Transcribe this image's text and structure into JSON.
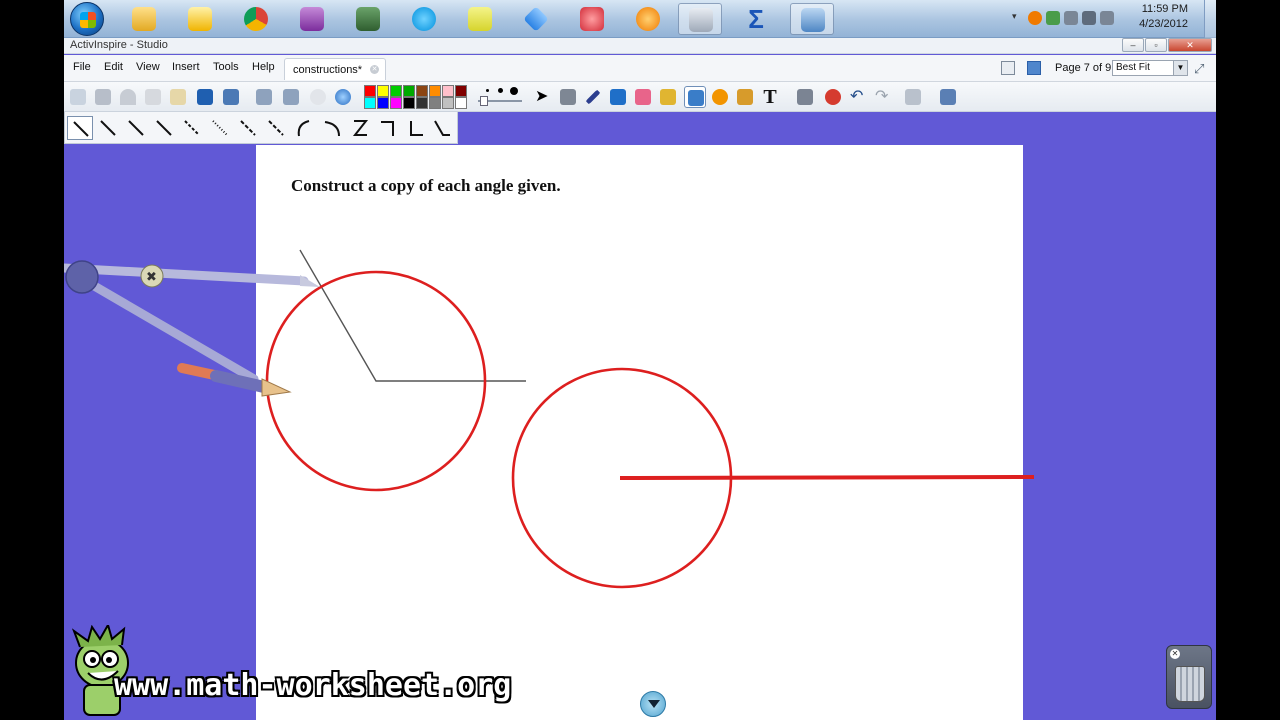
{
  "taskbar": {
    "pinned_apps": [
      "windows-explorer",
      "outlook",
      "chrome",
      "onenote",
      "calculator",
      "skype",
      "sticky-notes",
      "dropbox",
      "snipping-tool",
      "avast",
      "activinspire",
      "sigma",
      "remote-desktop"
    ],
    "clock": {
      "time": "11:59 PM",
      "date": "4/23/2012"
    }
  },
  "window": {
    "title": "ActivInspire - Studio",
    "controls": {
      "minimize": "–",
      "restore": "▫",
      "close": "✕"
    }
  },
  "menu": {
    "items": [
      "File",
      "Edit",
      "View",
      "Insert",
      "Tools",
      "Help"
    ],
    "document_tab": "constructions*",
    "page_indicator": "Page 7 of 9",
    "zoom": "Best Fit"
  },
  "palette": {
    "colors": [
      "#000000",
      "#ffffff",
      "#ff0000",
      "#ffff00",
      "#00cc00",
      "#0000ff",
      "#8b4513",
      "#ff8c00",
      "#ffc0cb",
      "#c0c0c0",
      "#800000",
      "#00ffff",
      "#808080",
      "#ff00ff",
      "#00ff00",
      "#333333"
    ]
  },
  "canvas": {
    "instruction": "Construct a copy of each angle given.",
    "accent_red": "#dd1f1f",
    "background_blue": "#6159d6"
  },
  "watermark": "www.math-worksheet.org"
}
